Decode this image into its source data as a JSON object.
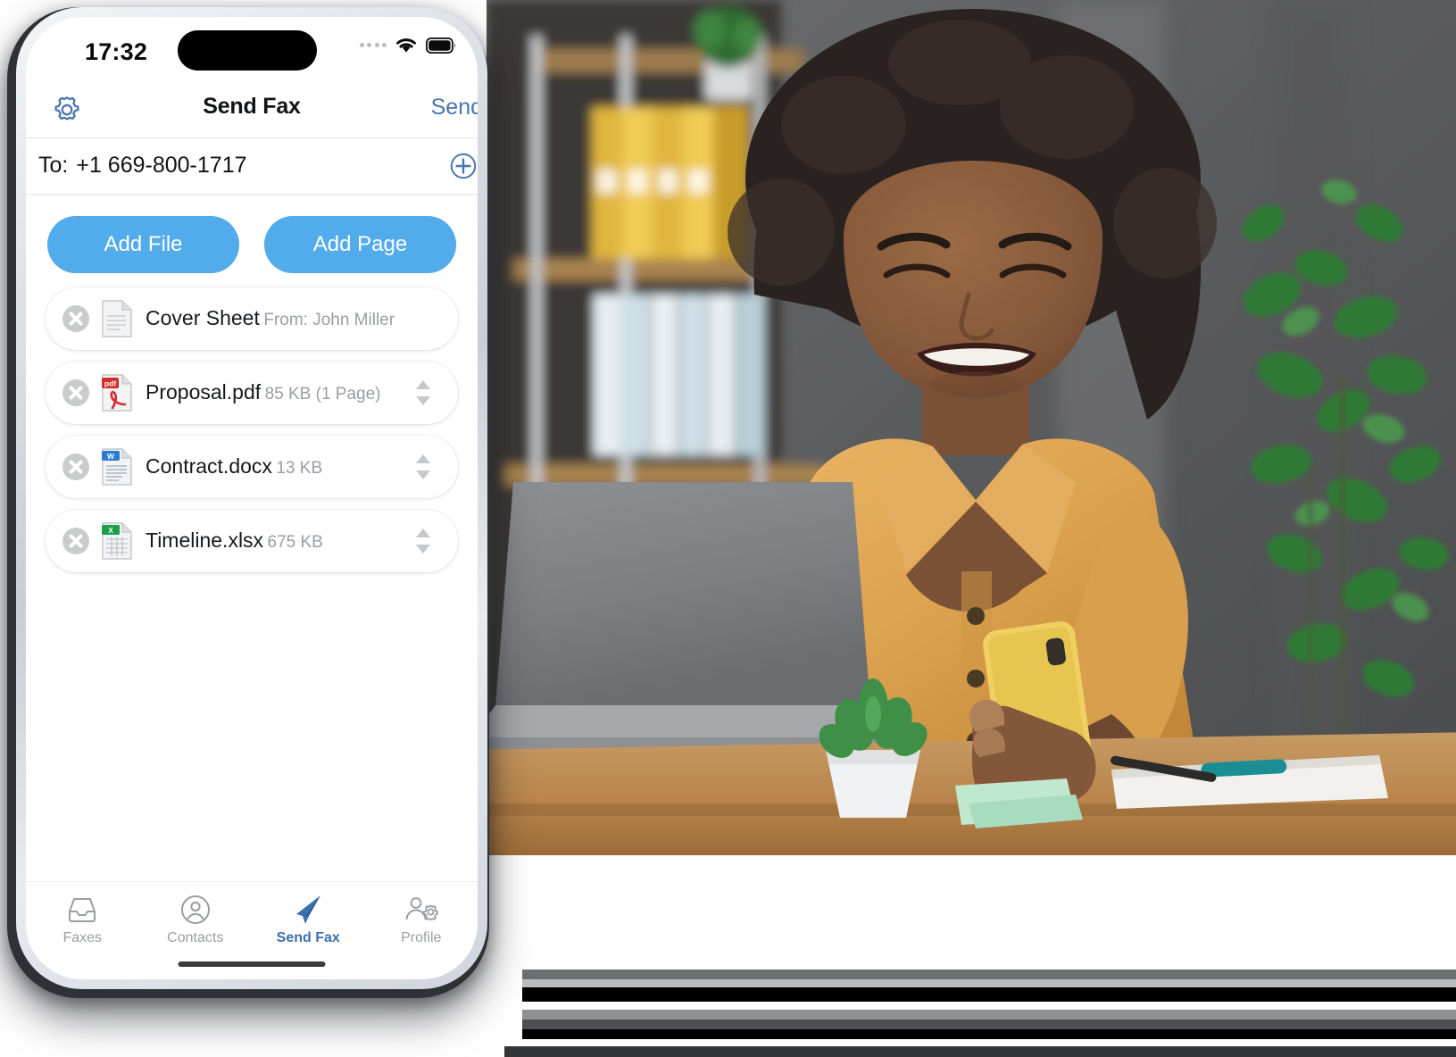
{
  "colors": {
    "accent_blue": "#52ABEA",
    "nav_link_blue": "#4a76ad",
    "active_tab_blue": "#3B6FAE",
    "muted_grey": "#9a9da3",
    "pdf_red": "#D62B2B",
    "word_blue": "#2B7CD3",
    "excel_green": "#1E9E4A"
  },
  "phone": {
    "status_bar": {
      "time": "17:32",
      "signal_icon": "signal-dots-icon",
      "wifi_icon": "wifi-icon",
      "battery_icon": "battery-icon",
      "dynamic_island": "dynamic-island"
    },
    "nav_bar": {
      "settings_icon": "gear-icon",
      "title": "Send Fax",
      "send_label": "Send"
    },
    "recipient_row": {
      "label": "To:",
      "value": "+1 669-800-1717",
      "add_contact_icon": "plus-circle-icon"
    },
    "actions": {
      "add_file_label": "Add File",
      "add_page_label": "Add Page"
    },
    "files": [
      {
        "name": "Cover Sheet",
        "sub": "From: John Miller",
        "icon": "document-icon",
        "remove_icon": "remove-circle-icon",
        "reorderable": false
      },
      {
        "name": "Proposal.pdf",
        "sub": "85 KB (1 Page)",
        "icon": "pdf-file-icon",
        "remove_icon": "remove-circle-icon",
        "reorderable": true
      },
      {
        "name": "Contract.docx",
        "sub": "13 KB",
        "icon": "word-file-icon",
        "remove_icon": "remove-circle-icon",
        "reorderable": true
      },
      {
        "name": "Timeline.xlsx",
        "sub": "675 KB",
        "icon": "excel-file-icon",
        "remove_icon": "remove-circle-icon",
        "reorderable": true
      }
    ],
    "tab_bar": {
      "tabs": [
        {
          "label": "Faxes",
          "icon": "inbox-icon",
          "active": false
        },
        {
          "label": "Contacts",
          "icon": "person-circle-icon",
          "active": false
        },
        {
          "label": "Send Fax",
          "icon": "paper-plane-icon",
          "active": true
        },
        {
          "label": "Profile",
          "icon": "person-gear-icon",
          "active": false
        }
      ],
      "home_indicator": "home-indicator"
    }
  },
  "photo": {
    "description": "woman-at-desk-with-laptop-and-phone"
  }
}
